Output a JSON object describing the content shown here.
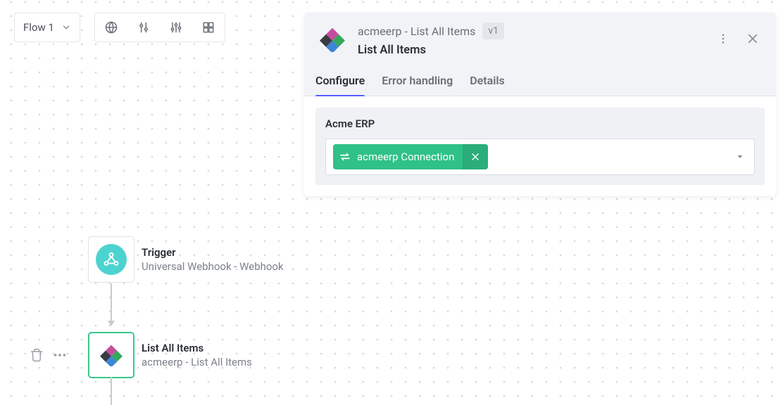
{
  "toolbar": {
    "flow_label": "Flow 1"
  },
  "panel": {
    "path": "acmeerp - List All Items",
    "version": "v1",
    "title": "List All Items",
    "tabs": [
      {
        "label": "Configure",
        "active": true
      },
      {
        "label": "Error handling",
        "active": false
      },
      {
        "label": "Details",
        "active": false
      }
    ],
    "field": {
      "label": "Acme ERP",
      "connection_chip": "acmeerp Connection"
    }
  },
  "flow": {
    "trigger": {
      "title": "Trigger",
      "subtitle": "Universal Webhook - Webhook"
    },
    "step": {
      "title": "List All Items",
      "subtitle": "acmeerp - List All Items"
    }
  }
}
